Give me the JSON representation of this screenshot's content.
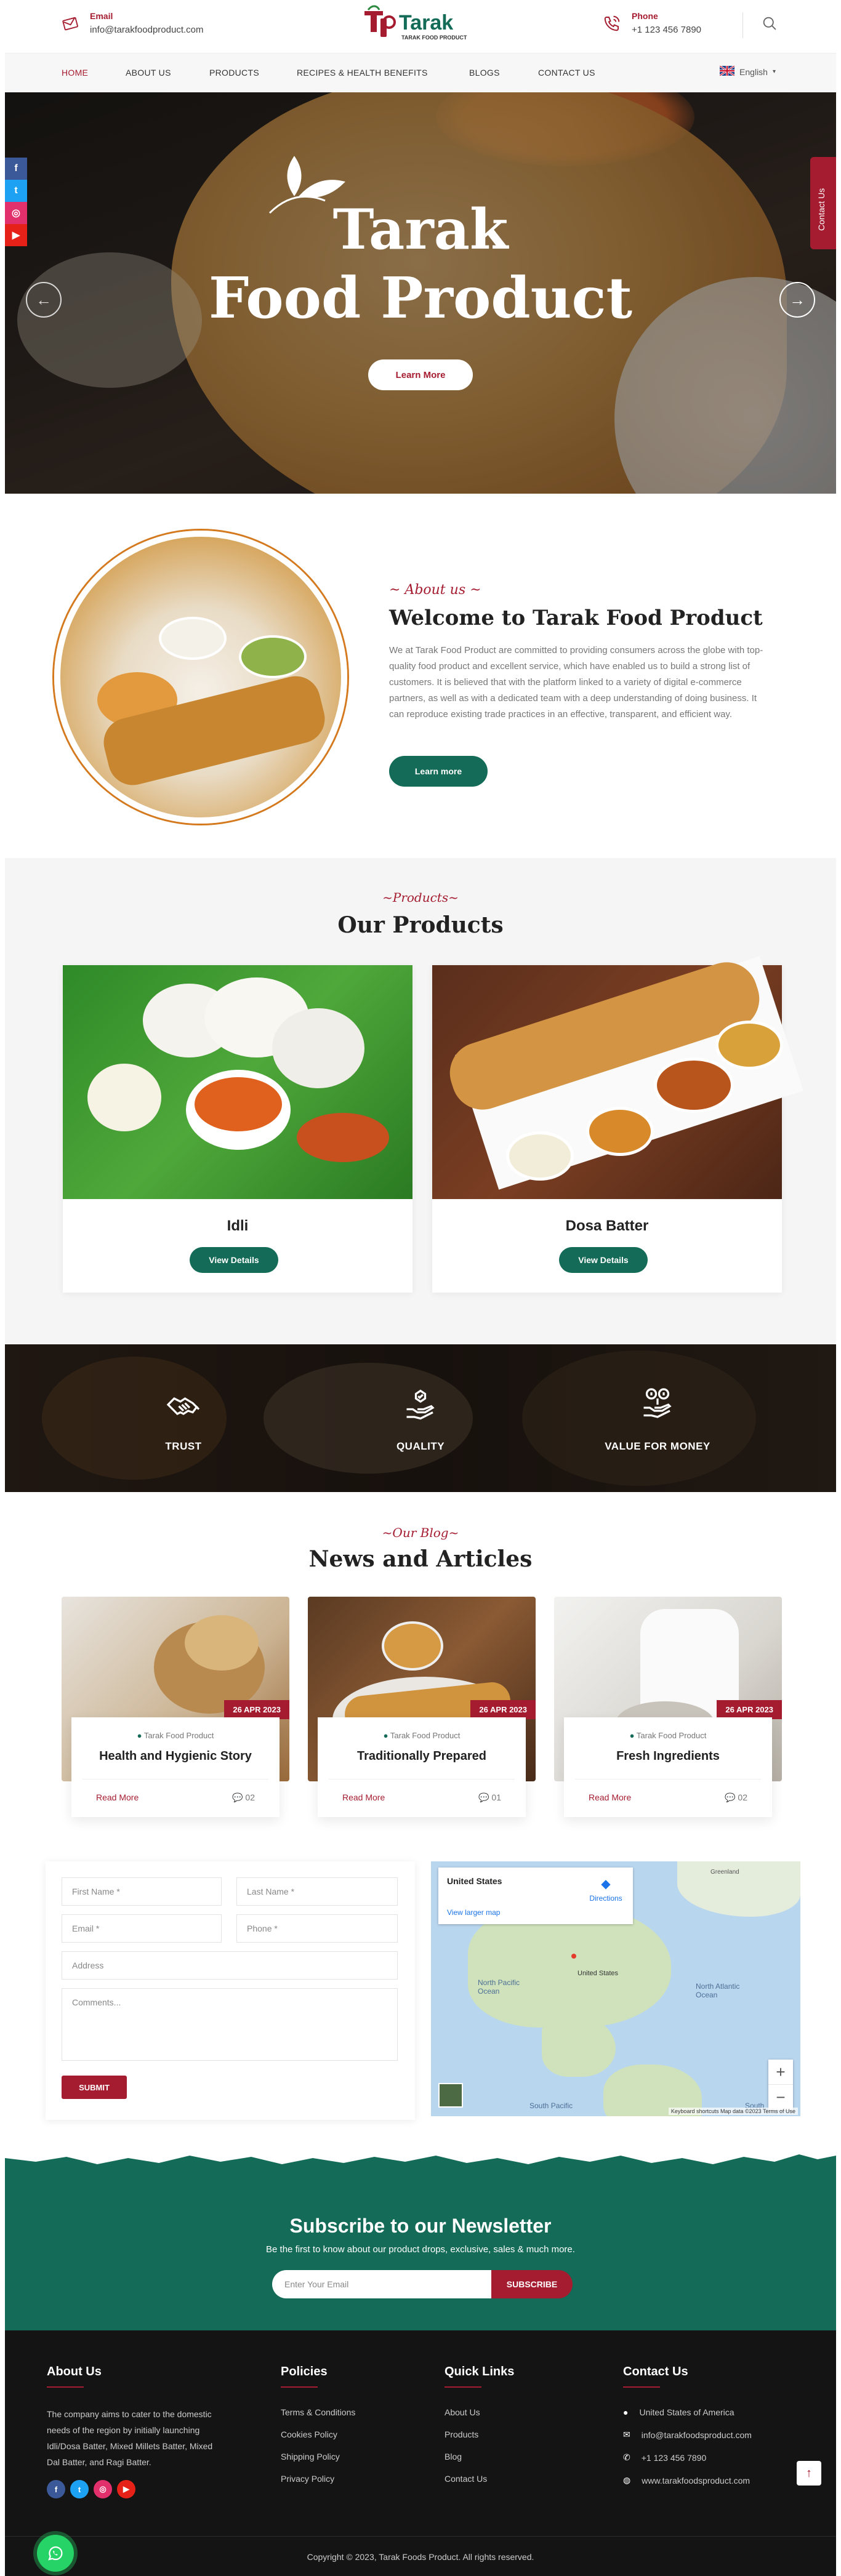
{
  "header": {
    "email_label": "Email",
    "email_value": "info@tarakfoodproduct.com",
    "phone_label": "Phone",
    "phone_value": "+1 123 456 7890",
    "logo_text": "Tarak",
    "logo_tagline": "TARAK FOOD PRODUCT"
  },
  "nav": {
    "items": [
      "HOME",
      "ABOUT US",
      "PRODUCTS",
      "RECIPES & HEALTH BENEFITS",
      "BLOGS",
      "CONTACT US"
    ],
    "active": "HOME",
    "language": "English"
  },
  "hero": {
    "title_line1": "Tarak",
    "title_line2": "Food Product",
    "button": "Learn More"
  },
  "side": {
    "contact_tab": "Contact Us"
  },
  "about": {
    "kicker": "~ About us ~",
    "title": "Welcome to Tarak Food Product",
    "text": "We at Tarak Food Product are committed to providing consumers across the globe with top-quality food product and excellent service, which have enabled us to build a strong list of customers. It is believed that with the platform linked to a variety of digital e-commerce partners, as well as with a dedicated team with a deep understanding of doing business. It can reproduce existing trade practices in an effective, transparent, and efficient way.",
    "button": "Learn more"
  },
  "products": {
    "kicker": "~Products~",
    "title": "Our Products",
    "items": [
      {
        "name": "Idli",
        "button": "View Details"
      },
      {
        "name": "Dosa Batter",
        "button": "View Details"
      }
    ]
  },
  "features": [
    {
      "label": "TRUST",
      "icon": "handshake-icon"
    },
    {
      "label": "QUALITY",
      "icon": "quality-hand-icon"
    },
    {
      "label": "VALUE FOR MONEY",
      "icon": "money-icon"
    }
  ],
  "blog": {
    "kicker": "~Our Blog~",
    "title": "News and Articles",
    "posts": [
      {
        "date": "26 APR 2023",
        "author": "Tarak Food Product",
        "title": "Health and Hygienic Story",
        "read": "Read More",
        "comments": "02"
      },
      {
        "date": "26 APR 2023",
        "author": "Tarak Food Product",
        "title": "Traditionally Prepared",
        "read": "Read More",
        "comments": "01"
      },
      {
        "date": "26 APR 2023",
        "author": "Tarak Food Product",
        "title": "Fresh Ingredients",
        "read": "Read More",
        "comments": "02"
      }
    ]
  },
  "form": {
    "first_name": "First Name *",
    "last_name": "Last Name *",
    "email": "Email *",
    "phone": "Phone *",
    "address": "Address",
    "comments": "Comments...",
    "submit": "SUBMIT"
  },
  "map": {
    "place": "United States",
    "larger_map": "View larger map",
    "directions": "Directions",
    "labels": [
      "United States",
      "North Pacific Ocean",
      "North Atlantic Ocean",
      "Greenland",
      "South Pacific",
      "South"
    ],
    "attribution": "Keyboard shortcuts   Map data ©2023   Terms of Use"
  },
  "newsletter": {
    "title": "Subscribe to our Newsletter",
    "subtitle": "Be the first to know about our product drops, exclusive, sales & much more.",
    "placeholder": "Enter Your Email",
    "button": "SUBSCRIBE"
  },
  "footer": {
    "about_title": "About Us",
    "about_text": "The company aims to cater to the domestic needs of the region by initially launching Idli/Dosa Batter, Mixed Millets Batter, Mixed Dal Batter, and Ragi Batter.",
    "policies_title": "Policies",
    "policies": [
      "Terms & Conditions",
      "Cookies Policy",
      "Shipping Policy",
      "Privacy Policy"
    ],
    "quick_title": "Quick Links",
    "quick": [
      "About Us",
      "Products",
      "Blog",
      "Contact Us"
    ],
    "contact_title": "Contact Us",
    "contact": [
      "United States of America",
      "info@tarakfoodsproduct.com",
      "+1 123 456 7890",
      "www.tarakfoodsproduct.com"
    ],
    "copyright": "Copyright © 2023, Tarak Foods Product. All rights reserved."
  },
  "colors": {
    "brand_red": "#a51c30",
    "brand_green": "#146b57",
    "footer_bg": "#141414"
  }
}
